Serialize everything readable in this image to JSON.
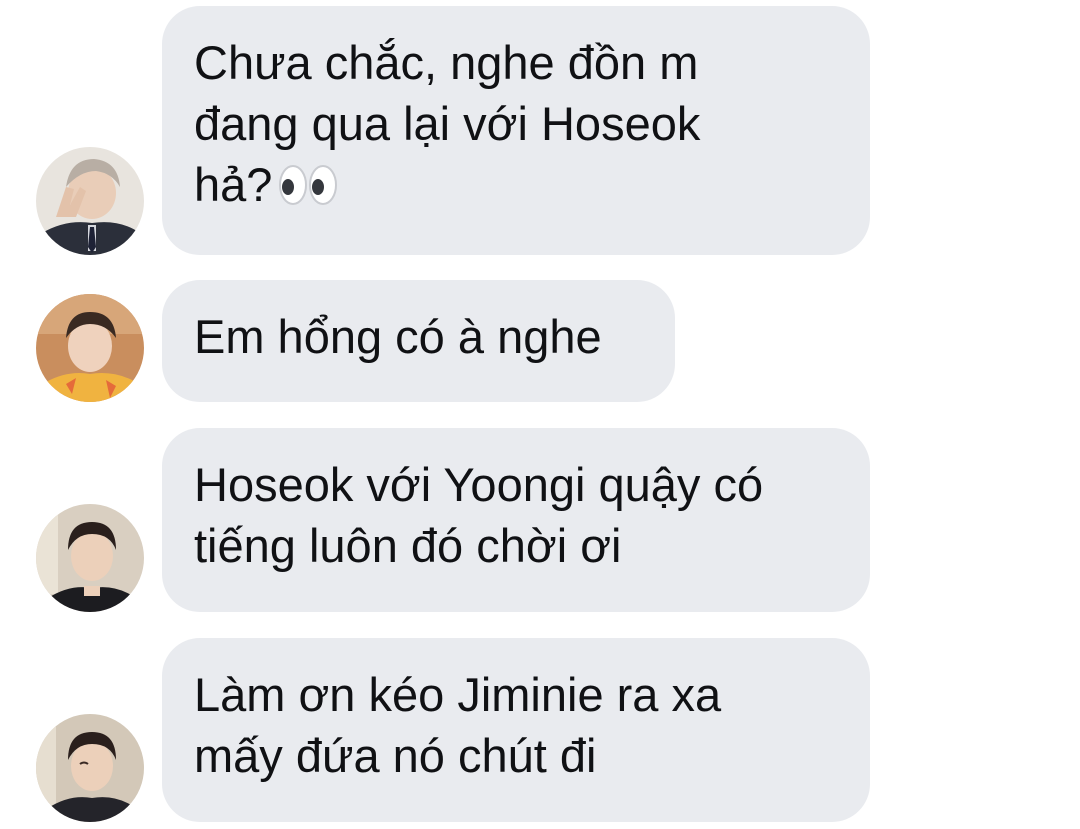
{
  "conversation": {
    "messages": [
      {
        "sender_avatar": "avatar-person-peace-sign",
        "text": "Chưa chắc, nghe đồn m\nđang qua lại với Hoseok\nhả?",
        "emoji": "eyes-icon"
      },
      {
        "sender_avatar": "avatar-person-orange-shirt",
        "text": "Em hổng có à nghe"
      },
      {
        "sender_avatar": "avatar-person-dark-hair",
        "text": "Hoseok với Yoongi quậy có\ntiếng luôn đó chời ơi"
      },
      {
        "sender_avatar": "avatar-person-winking",
        "text": "Làm ơn kéo Jiminie ra xa\nmấy đứa nó chút đi"
      }
    ]
  },
  "colors": {
    "bubble_background": "#e9ebef",
    "text": "#101114",
    "page_background": "#ffffff"
  }
}
